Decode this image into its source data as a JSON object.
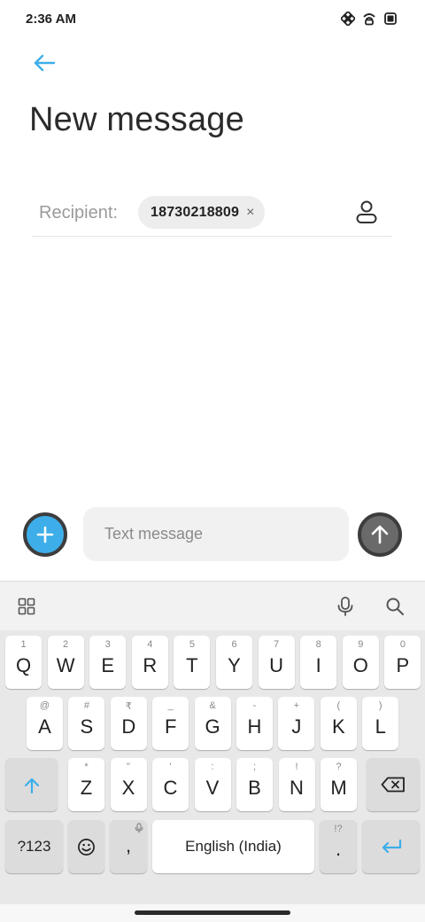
{
  "status": {
    "time": "2:36 AM"
  },
  "header": {
    "title": "New message"
  },
  "recipient": {
    "label": "Recipient:",
    "chip": "18730218809",
    "chip_close": "×"
  },
  "compose": {
    "placeholder": "Text message",
    "value": ""
  },
  "keyboard": {
    "row1": [
      {
        "hint": "1",
        "key": "Q"
      },
      {
        "hint": "2",
        "key": "W"
      },
      {
        "hint": "3",
        "key": "E"
      },
      {
        "hint": "4",
        "key": "R"
      },
      {
        "hint": "5",
        "key": "T"
      },
      {
        "hint": "6",
        "key": "Y"
      },
      {
        "hint": "7",
        "key": "U"
      },
      {
        "hint": "8",
        "key": "I"
      },
      {
        "hint": "9",
        "key": "O"
      },
      {
        "hint": "0",
        "key": "P"
      }
    ],
    "row2": [
      {
        "hint": "@",
        "key": "A"
      },
      {
        "hint": "#",
        "key": "S"
      },
      {
        "hint": "₹",
        "key": "D"
      },
      {
        "hint": "_",
        "key": "F"
      },
      {
        "hint": "&",
        "key": "G"
      },
      {
        "hint": "-",
        "key": "H"
      },
      {
        "hint": "+",
        "key": "J"
      },
      {
        "hint": "(",
        "key": "K"
      },
      {
        "hint": ")",
        "key": "L"
      }
    ],
    "row3": [
      {
        "hint": "*",
        "key": "Z"
      },
      {
        "hint": "\"",
        "key": "X"
      },
      {
        "hint": "'",
        "key": "C"
      },
      {
        "hint": ":",
        "key": "V"
      },
      {
        "hint": ";",
        "key": "B"
      },
      {
        "hint": "!",
        "key": "N"
      },
      {
        "hint": "?",
        "key": "M"
      }
    ],
    "symbols_key": "?123",
    "comma_key": ",",
    "space_key": "English (India)",
    "period_key": ".",
    "period_hint": "!?"
  },
  "colors": {
    "accent": "#3daee9",
    "send": "#6a6a6a",
    "keyboard_bg": "#e8e8e8"
  }
}
